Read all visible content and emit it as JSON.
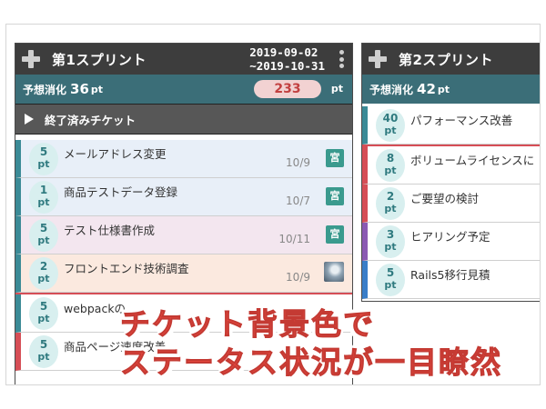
{
  "sprint1": {
    "title": "第1スプリント",
    "date_start": "2019-09-02",
    "date_end": "~2019-10-31",
    "estimate_label": "予想消化",
    "estimate_value": "36",
    "estimate_unit": "pt",
    "pill_value": "233",
    "pill_unit": "pt",
    "done_label": "終了済みチケット",
    "tickets": [
      {
        "points": "5",
        "unit": "pt",
        "title": "メールアドレス変更",
        "date": "10/9",
        "badge": "宮"
      },
      {
        "points": "1",
        "unit": "pt",
        "title": "商品テストデータ登録",
        "date": "10/7",
        "badge": "宮"
      },
      {
        "points": "5",
        "unit": "pt",
        "title": "テスト仕様書作成",
        "date": "10/11",
        "badge": "宮"
      },
      {
        "points": "2",
        "unit": "pt",
        "title": "フロントエンド技術調査",
        "date": "10/9",
        "badge": ""
      },
      {
        "points": "5",
        "unit": "pt",
        "title": "webpackの"
      },
      {
        "points": "5",
        "unit": "pt",
        "title": "商品ページ速度改善"
      }
    ]
  },
  "sprint2": {
    "title": "第2スプリント",
    "estimate_label": "予想消化",
    "estimate_value": "42",
    "estimate_unit": "pt",
    "tickets": [
      {
        "points": "40",
        "unit": "pt",
        "title": "パフォーマンス改善"
      },
      {
        "points": "8",
        "unit": "pt",
        "title": "ボリュームライセンスに"
      },
      {
        "points": "2",
        "unit": "pt",
        "title": "ご要望の検討"
      },
      {
        "points": "3",
        "unit": "pt",
        "title": "ヒアリング予定"
      },
      {
        "points": "5",
        "unit": "pt",
        "title": "Rails5移行見積"
      }
    ]
  },
  "overlay": {
    "line1": "チケット背景色で",
    "line2": "ステータス状況が一目瞭然"
  },
  "colors": {
    "header": "#3d3d3d",
    "estimate_bar": "#3b6e78",
    "teal_border": "#3b8a96",
    "red_border": "#d64e56",
    "purple_border": "#8b5ab3",
    "blue_border": "#3a7ec8",
    "overlay_text": "#e8473e"
  }
}
